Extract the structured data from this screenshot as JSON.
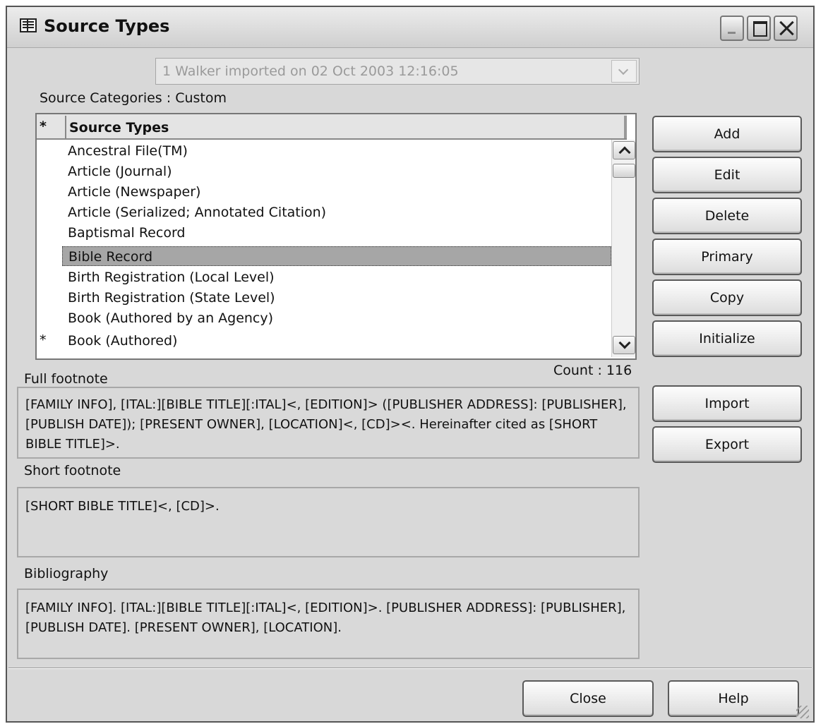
{
  "window": {
    "title": "Source Types"
  },
  "selector": {
    "value": "1 Walker imported on 02 Oct 2003 12:16:05"
  },
  "category_label": "Source Categories : Custom",
  "list": {
    "header_star": "*",
    "column_title": "Source Types",
    "rows": [
      {
        "label": "Ancestral File(TM)",
        "marker": ""
      },
      {
        "label": "Article (Journal)",
        "marker": ""
      },
      {
        "label": "Article (Newspaper)",
        "marker": ""
      },
      {
        "label": "Article (Serialized; Annotated Citation)",
        "marker": ""
      },
      {
        "label": "Baptismal Record",
        "marker": ""
      },
      {
        "label": "Bible Record",
        "marker": "",
        "selected": true
      },
      {
        "label": "Birth Registration (Local Level)",
        "marker": ""
      },
      {
        "label": "Birth Registration (State Level)",
        "marker": ""
      },
      {
        "label": "Book (Authored by an Agency)",
        "marker": ""
      },
      {
        "label": "Book (Authored)",
        "marker": "*"
      }
    ],
    "count_text": "Count : 116"
  },
  "full_footnote": {
    "label": "Full footnote",
    "text": "[FAMILY INFO], [ITAL:][BIBLE TITLE][:ITAL]<, [EDITION]> ([PUBLISHER ADDRESS]: [PUBLISHER], [PUBLISH DATE]); [PRESENT OWNER], [LOCATION]<, [CD]><. Hereinafter cited as [SHORT BIBLE TITLE]>."
  },
  "short_footnote": {
    "label": "Short footnote",
    "text": "[SHORT BIBLE TITLE]<, [CD]>."
  },
  "bibliography": {
    "label": "Bibliography",
    "text": "[FAMILY INFO]. [ITAL:][BIBLE TITLE][:ITAL]<, [EDITION]>. [PUBLISHER ADDRESS]: [PUBLISHER], [PUBLISH DATE]. [PRESENT OWNER], [LOCATION]."
  },
  "buttons": {
    "add": "Add",
    "edit": "Edit",
    "delete": "Delete",
    "primary": "Primary",
    "copy": "Copy",
    "initialize": "Initialize",
    "import": "Import",
    "export": "Export",
    "close": "Close",
    "help": "Help"
  }
}
